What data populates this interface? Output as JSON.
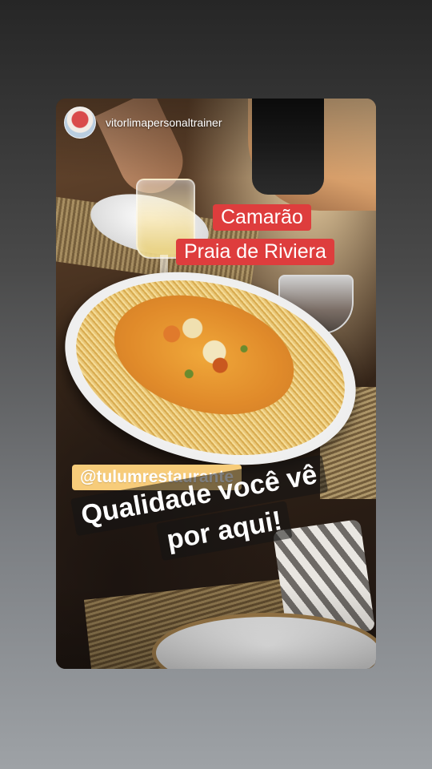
{
  "story": {
    "username": "vitorlimapersonaltrainer",
    "dish_title_line1": "Camarão",
    "dish_title_line2": "Praia de Riviera",
    "mention": "@tulumrestaurante",
    "caption_line1": "Qualidade você vê",
    "caption_line2": "por aqui!"
  },
  "colors": {
    "dish_tag_background": "#de3d3d",
    "mention_background": "#f7cc7a",
    "caption_background": "rgba(20,20,20,0.55)",
    "page_background_top": "#262626",
    "page_background_bottom": "#9ea2a6"
  }
}
